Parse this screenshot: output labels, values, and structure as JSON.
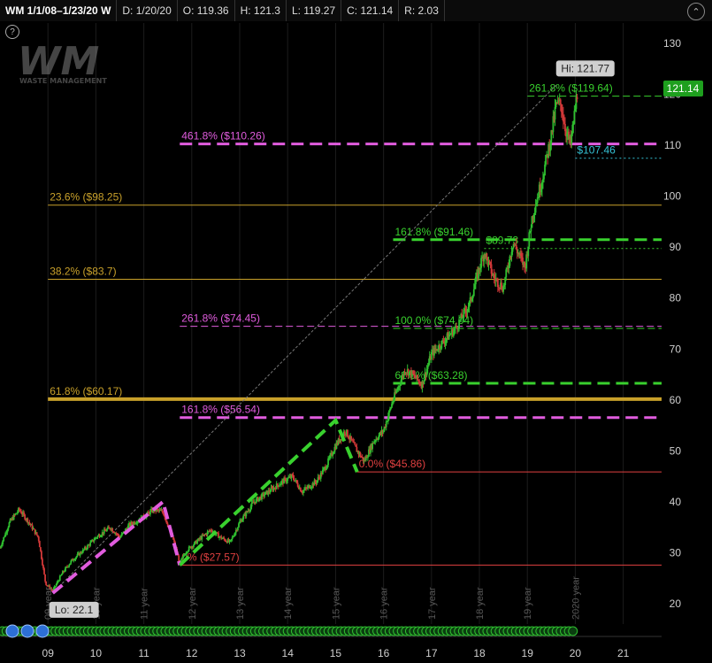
{
  "header": {
    "title": "WM 1/1/08–1/23/20 W",
    "date": "D: 1/20/20",
    "open": "O: 119.36",
    "high": "H: 121.3",
    "low": "L: 119.27",
    "close": "C: 121.14",
    "range": "R: 2.03"
  },
  "logo": {
    "text": "WM",
    "subtitle": "WASTE MANAGEMENT"
  },
  "chart_data": {
    "type": "candlestick",
    "symbol": "WM",
    "interval": "weekly",
    "x_ticks": [
      "09",
      "10",
      "11",
      "12",
      "13",
      "14",
      "15",
      "16",
      "17",
      "18",
      "19",
      "20",
      "21"
    ],
    "y_ticks": [
      20,
      30,
      40,
      50,
      60,
      70,
      80,
      90,
      100,
      110,
      120,
      130
    ],
    "ylim": [
      16,
      134
    ],
    "xlim": [
      2008.0,
      2021.8
    ],
    "last_price": "121.14",
    "high_label": "Hi: 121.77",
    "low_label": "Lo: 22.1",
    "price_path": [
      [
        2008.0,
        31
      ],
      [
        2008.2,
        36
      ],
      [
        2008.4,
        38.5
      ],
      [
        2008.6,
        36
      ],
      [
        2008.8,
        33
      ],
      [
        2008.95,
        24
      ],
      [
        2009.1,
        22.5
      ],
      [
        2009.3,
        26
      ],
      [
        2009.5,
        28.5
      ],
      [
        2009.8,
        31
      ],
      [
        2010.0,
        33
      ],
      [
        2010.3,
        35
      ],
      [
        2010.5,
        33
      ],
      [
        2010.7,
        35.5
      ],
      [
        2011.0,
        37
      ],
      [
        2011.2,
        38.5
      ],
      [
        2011.4,
        38
      ],
      [
        2011.6,
        33
      ],
      [
        2011.75,
        28
      ],
      [
        2011.9,
        30.5
      ],
      [
        2012.2,
        33
      ],
      [
        2012.4,
        34.5
      ],
      [
        2012.6,
        33
      ],
      [
        2012.8,
        32
      ],
      [
        2013.0,
        36
      ],
      [
        2013.3,
        40
      ],
      [
        2013.6,
        42
      ],
      [
        2013.9,
        44
      ],
      [
        2014.1,
        45
      ],
      [
        2014.3,
        42
      ],
      [
        2014.6,
        44
      ],
      [
        2014.8,
        47
      ],
      [
        2015.0,
        51
      ],
      [
        2015.2,
        54
      ],
      [
        2015.45,
        50
      ],
      [
        2015.6,
        48
      ],
      [
        2015.8,
        52
      ],
      [
        2016.0,
        54
      ],
      [
        2016.2,
        60
      ],
      [
        2016.45,
        66
      ],
      [
        2016.6,
        65
      ],
      [
        2016.8,
        63
      ],
      [
        2017.0,
        69
      ],
      [
        2017.3,
        72
      ],
      [
        2017.5,
        74
      ],
      [
        2017.8,
        79
      ],
      [
        2018.0,
        86
      ],
      [
        2018.1,
        89
      ],
      [
        2018.3,
        84
      ],
      [
        2018.5,
        82
      ],
      [
        2018.7,
        91
      ],
      [
        2018.95,
        86
      ],
      [
        2019.1,
        96
      ],
      [
        2019.3,
        103
      ],
      [
        2019.5,
        112
      ],
      [
        2019.6,
        118
      ],
      [
        2019.7,
        118
      ],
      [
        2019.8,
        113
      ],
      [
        2019.9,
        110
      ],
      [
        2020.05,
        121
      ]
    ],
    "fib_lines": [
      {
        "label": "261.8%  ($119.64)",
        "value": 119.64,
        "x_start": 2019.0,
        "x_end": 2021.0,
        "style": "dashed-thin",
        "color": "#39d12e"
      },
      {
        "label": "461.8%  ($110.26)",
        "value": 110.26,
        "x_start": 2011.75,
        "x_end": 2021.0,
        "style": "dashed-thick",
        "color": "#e15cde"
      },
      {
        "label": "$107.46",
        "value": 107.46,
        "x_start": 2020.0,
        "x_end": 2021.0,
        "style": "dotted",
        "color": "#35c3d6"
      },
      {
        "label": "23.6%  ($98.25)",
        "value": 98.25,
        "x_start": 2009.0,
        "x_end": 2021.0,
        "style": "solid",
        "color": "#c8a02a"
      },
      {
        "label": "161.8%  ($91.46)",
        "value": 91.46,
        "x_start": 2016.2,
        "x_end": 2021.0,
        "style": "dashed-thick",
        "color": "#39d12e"
      },
      {
        "label": "$89.73",
        "value": 89.73,
        "x_start": 2018.1,
        "x_end": 2021.0,
        "style": "dotted",
        "color": "#39d12e"
      },
      {
        "label": "38.2%  ($83.7)",
        "value": 83.7,
        "x_start": 2009.0,
        "x_end": 2021.0,
        "style": "solid",
        "color": "#c8a02a"
      },
      {
        "label": "261.8%  ($74.45)",
        "value": 74.45,
        "x_start": 2011.75,
        "x_end": 2021.0,
        "style": "dashed-thin",
        "color": "#e15cde"
      },
      {
        "label": "100.0%  ($74.04)",
        "value": 74.04,
        "x_start": 2016.2,
        "x_end": 2021.0,
        "style": "dashed-thin",
        "color": "#39d12e"
      },
      {
        "label": "61.8%  ($63.28)",
        "value": 63.28,
        "x_start": 2016.2,
        "x_end": 2021.0,
        "style": "dashed-thick",
        "color": "#39d12e"
      },
      {
        "label": "61.8%  ($60.17)",
        "value": 60.17,
        "x_start": 2009.0,
        "x_end": 2021.0,
        "style": "solid-thick",
        "color": "#c8a02a"
      },
      {
        "label": "161.8%  ($56.54)",
        "value": 56.54,
        "x_start": 2011.75,
        "x_end": 2021.0,
        "style": "dashed-thick",
        "color": "#e15cde"
      },
      {
        "label": "0.0%  ($45.86)",
        "value": 45.86,
        "x_start": 2015.45,
        "x_end": 2021.0,
        "style": "solid",
        "color": "#e04040"
      },
      {
        "label": "0%  ($27.57)",
        "value": 27.57,
        "x_start": 2011.75,
        "x_end": 2021.0,
        "style": "solid",
        "color": "#e04040"
      }
    ],
    "swing_lines": [
      {
        "color": "#e15cde",
        "points": [
          [
            2009.1,
            22.1
          ],
          [
            2011.4,
            40
          ],
          [
            2011.75,
            27.57
          ]
        ]
      },
      {
        "color": "#39d12e",
        "points": [
          [
            2011.75,
            27.57
          ],
          [
            2015.0,
            56
          ],
          [
            2015.45,
            45.86
          ]
        ]
      }
    ],
    "trend_line": {
      "color": "#777",
      "points": [
        [
          2009.1,
          22.1
        ],
        [
          2019.6,
          121.77
        ]
      ]
    },
    "year_markers": [
      "09 year",
      "10 year",
      "11 year",
      "12 year",
      "13 year",
      "14 year",
      "15 year",
      "16 year",
      "17 year",
      "18 year",
      "19 year",
      "2020 year"
    ],
    "colors": {
      "up": "#2fbf2f",
      "down": "#d13838",
      "axis_text": "#cfcfcf",
      "grid": "#1c1c1c",
      "price_tag_bg": "#1e9f1e"
    }
  }
}
